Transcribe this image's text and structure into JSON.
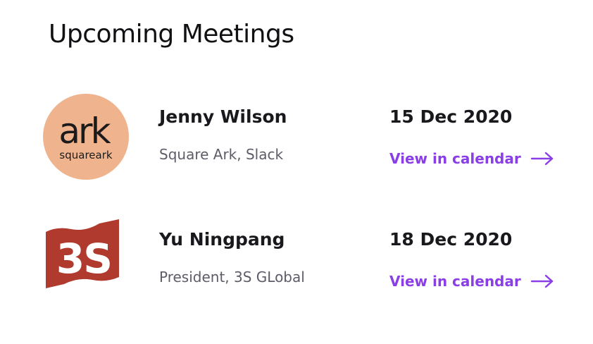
{
  "header": {
    "title": "Upcoming Meetings"
  },
  "meetings": [
    {
      "name": "Jenny Wilson",
      "company": "Square Ark, Slack",
      "date": "15 Dec 2020",
      "link_label": "View in calendar",
      "logo": {
        "text_main": "ark",
        "text_sub": "squareark",
        "bg_color": "#EFB38E"
      }
    },
    {
      "name": "Yu Ningpang",
      "company": "President, 3S GLobal",
      "date": "18 Dec 2020",
      "link_label": "View in calendar",
      "logo": {
        "text_main": "3S",
        "bg_color": "#B03A2E"
      }
    }
  ],
  "colors": {
    "accent": "#8A3EE6",
    "text_primary": "#19191D",
    "text_secondary": "#5D5D68"
  }
}
